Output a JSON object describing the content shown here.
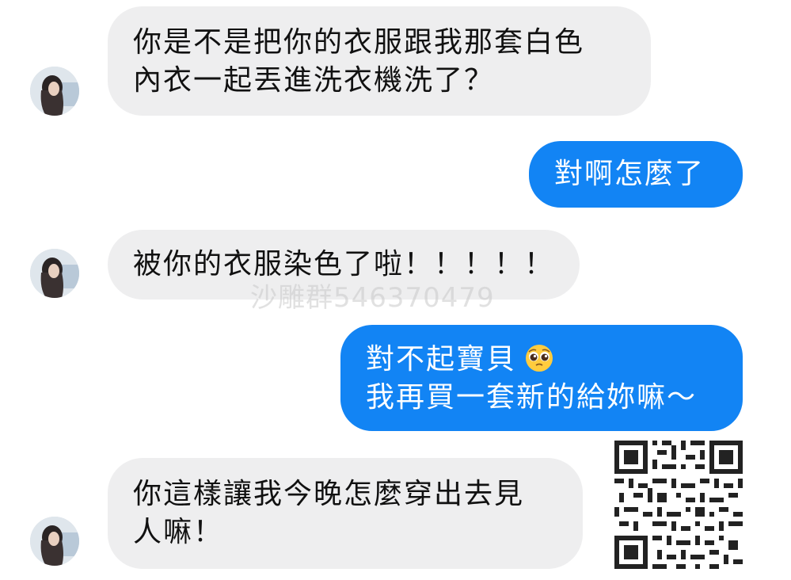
{
  "messages": [
    {
      "direction": "incoming",
      "lines": [
        "你是不是把你的衣服跟我那套白色",
        "內衣一起丟進洗衣機洗了？"
      ]
    },
    {
      "direction": "outgoing",
      "lines": [
        "對啊怎麼了"
      ]
    },
    {
      "direction": "incoming",
      "lines": [
        "被你的衣服染色了啦！！！！！"
      ]
    },
    {
      "direction": "outgoing",
      "lines": [
        "對不起寶貝",
        "我再買一套新的給妳嘛～"
      ],
      "emoji": "pleading-face"
    },
    {
      "direction": "incoming",
      "lines": [
        "你這樣讓我今晚怎麼穿出去見",
        "人嘛！"
      ]
    }
  ],
  "watermark": "沙雕群546370479",
  "colors": {
    "outgoing_bubble": "#1284f4",
    "incoming_bubble": "#eeeeef",
    "background": "#ffffff"
  },
  "icons": {
    "avatar": "contact-avatar",
    "qr": "qr-code"
  }
}
